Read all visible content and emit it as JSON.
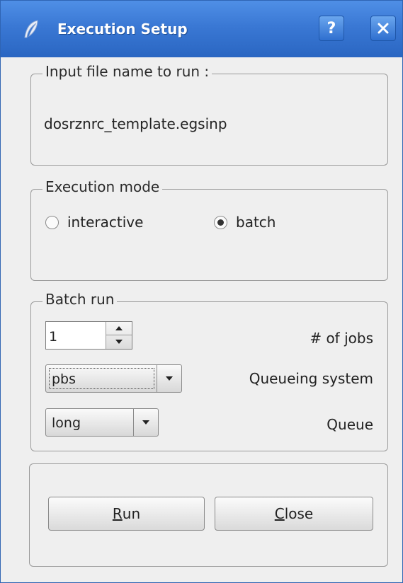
{
  "window": {
    "title": "Execution Setup",
    "help_button": "?",
    "close_icon": "close-icon",
    "title_color": "#3a78d4"
  },
  "input_group": {
    "title": "Input file name to run :",
    "filename": "dosrznrc_template.egsinp"
  },
  "mode_group": {
    "title": "Execution mode",
    "options": [
      {
        "label": "interactive",
        "selected": false
      },
      {
        "label": "batch",
        "selected": true
      }
    ]
  },
  "batch_group": {
    "title": "Batch run",
    "jobs_value": "1",
    "jobs_label": "# of jobs",
    "queue_system_value": "pbs",
    "queue_system_label": "Queueing system",
    "queue_value": "long",
    "queue_label": "Queue"
  },
  "buttons": {
    "run_mnemonic": "R",
    "run_rest": "un",
    "close_mnemonic": "C",
    "close_rest": "lose"
  }
}
